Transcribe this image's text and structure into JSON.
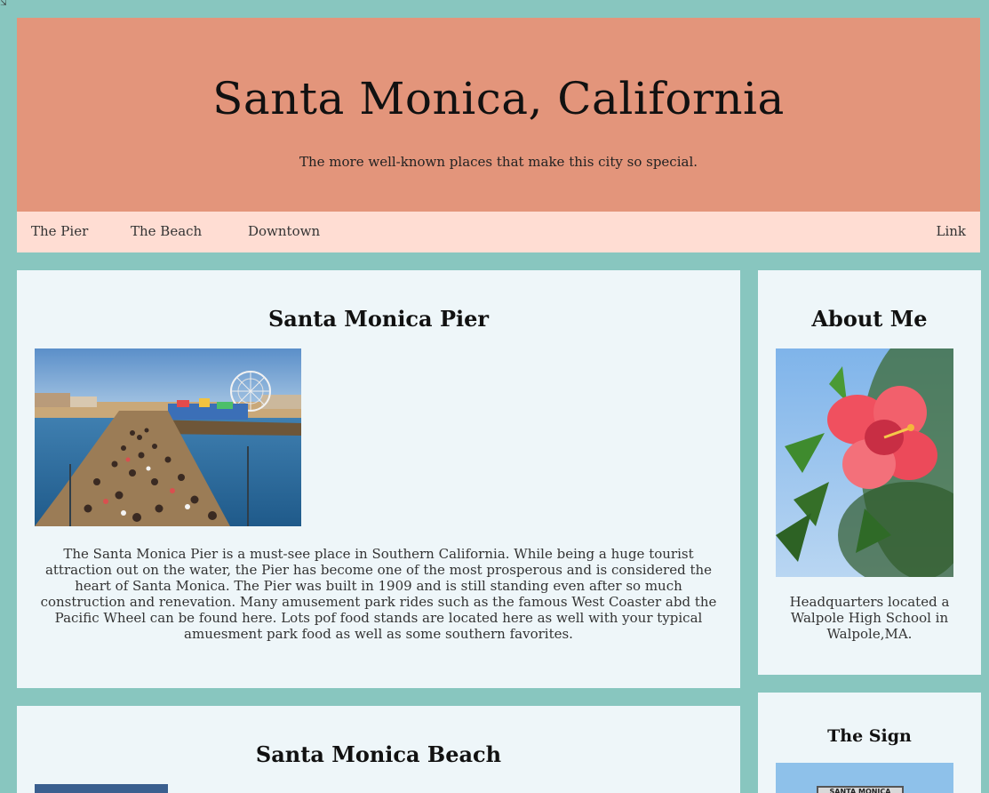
{
  "header": {
    "title": "Santa Monica, California",
    "subtitle": "The more well-known places that make this city so special."
  },
  "nav": {
    "items": [
      "The Pier",
      "The Beach",
      "Downtown"
    ],
    "right_link": "Link"
  },
  "pier_card": {
    "heading": "Santa Monica Pier",
    "image_subject": "Santa Monica Pier crowd and ferris wheel photo",
    "text": "The Santa Monica Pier is a must-see place in Southern California. While being a huge tourist attraction out on the water, the Pier has become one of the most prosperous and is considered the heart of Santa Monica. The Pier was built in 1909 and is still standing even after so much construction and renevation. Many amusement park rides such as the famous West Coaster abd the Pacific Wheel can be found here. Lots pof food stands are located here as well with your typical amuesment park food as well as some southern favorites."
  },
  "about_card": {
    "heading": "About Me",
    "image_subject": "Red hibiscus flower photo",
    "text": "Headquarters located a Walpole High School in Walpole,MA."
  },
  "beach_card": {
    "heading": "Santa Monica Beach"
  },
  "sign_card": {
    "heading": "The Sign",
    "sign_text": "SANTA MONICA"
  },
  "colors": {
    "page_background": "#88c6bf",
    "header_background": "#e3957b",
    "navbar_background": "#ffddd3",
    "card_background": "#eef6f9"
  }
}
